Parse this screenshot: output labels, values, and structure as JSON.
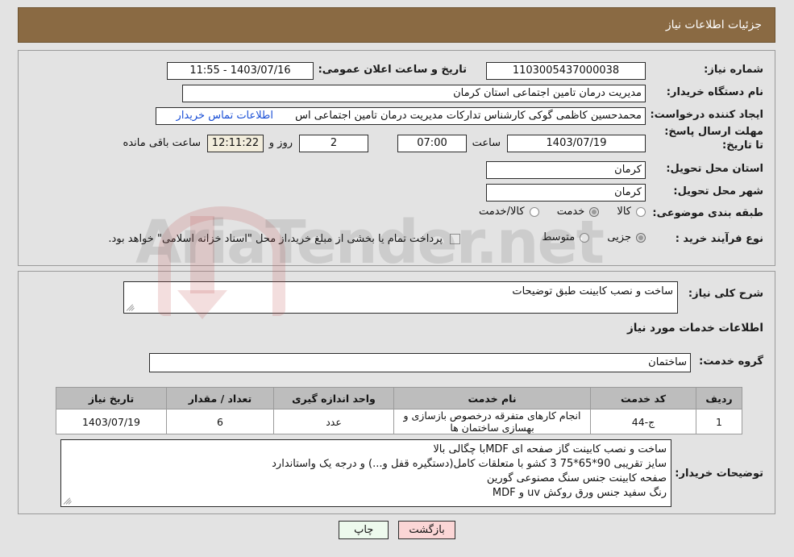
{
  "header": {
    "title": "جزئیات اطلاعات نیاز"
  },
  "summary": {
    "need_number_label": "شماره نیاز:",
    "need_number_value": "1103005437000038",
    "public_announce_label": "تاریخ و ساعت اعلان عمومی:",
    "public_announce_value": "1403/07/16 - 11:55",
    "buyer_org_label": "نام دستگاه خریدار:",
    "buyer_org_value": "مدیریت درمان تامین اجتماعی استان کرمان",
    "creator_label": "ایجاد کننده درخواست:",
    "creator_value": "محمدحسین کاظمی گوکی کارشناس تدارکات مدیریت درمان تامین اجتماعی اس",
    "contact_link": "اطلاعات تماس خریدار",
    "deadline_label": "مهلت ارسال پاسخ: تا تاریخ:",
    "deadline_date": "1403/07/19",
    "deadline_hour_label": "ساعت",
    "deadline_hour": "07:00",
    "remaining_days": "2",
    "remaining_days_label": "روز و",
    "remaining_time": "12:11:22",
    "remaining_time_label": "ساعت باقی مانده",
    "province_label": "استان محل تحویل:",
    "province_value": "کرمان",
    "city_label": "شهر محل تحویل:",
    "city_value": "کرمان",
    "category_label": "طبقه بندی موضوعی:",
    "category_options": [
      {
        "label": "کالا",
        "selected": false
      },
      {
        "label": "خدمت",
        "selected": true
      },
      {
        "label": "کالا/خدمت",
        "selected": false
      }
    ],
    "process_label": "نوع فرآیند خرید :",
    "process_options": [
      {
        "label": "جزیی",
        "selected": true
      },
      {
        "label": "متوسط",
        "selected": false
      }
    ],
    "treasury_checkbox_label": "پرداخت تمام یا بخشی از مبلغ خرید،از محل \"اسناد خزانه اسلامی\" خواهد بود.",
    "treasury_checked": false
  },
  "details": {
    "general_desc_label": "شرح کلی نیاز:",
    "general_desc_value": "ساخت و نصب کابینت طبق توضیحات",
    "services_section_title": "اطلاعات خدمات مورد نیاز",
    "service_group_label": "گروه خدمت:",
    "service_group_value": "ساختمان",
    "table": {
      "columns": [
        "ردیف",
        "کد خدمت",
        "نام خدمت",
        "واحد اندازه گیری",
        "تعداد / مقدار",
        "تاریخ نیاز"
      ],
      "rows": [
        {
          "index": "1",
          "service_code": "ج-44",
          "service_name": "انجام کارهای متفرقه درخصوص بازسازی و بهسازی ساختمان ها",
          "unit": "عدد",
          "quantity": "6",
          "need_date": "1403/07/19"
        }
      ]
    },
    "buyer_notes_label": "توضیحات خریدار:",
    "buyer_notes_lines": [
      "ساخت و نصب کابینت گاز صفحه ای MDFبا چگالی بالا",
      "سایز تقریبی 90*65*75 3 کشو با متعلقات کامل(دستگیره قفل و...) و درجه یک واستاندارد",
      "صفحه کابینت جنس سنگ مصنوعی گورین",
      "رنگ سفید جنس ورق روکش uv و MDF"
    ]
  },
  "buttons": {
    "print": "چاپ",
    "back": "بازگشت"
  },
  "watermark": {
    "text": "AriaTender.net"
  },
  "colors": {
    "header_bg": "#8a6a43",
    "page_bg": "#e3e3e3",
    "link": "#1a4fd6",
    "table_header_bg": "#bdbdbd",
    "print_btn_bg": "#edfaed",
    "back_btn_bg": "#fbd6d6",
    "highlight_field_bg": "#f2eddc"
  }
}
